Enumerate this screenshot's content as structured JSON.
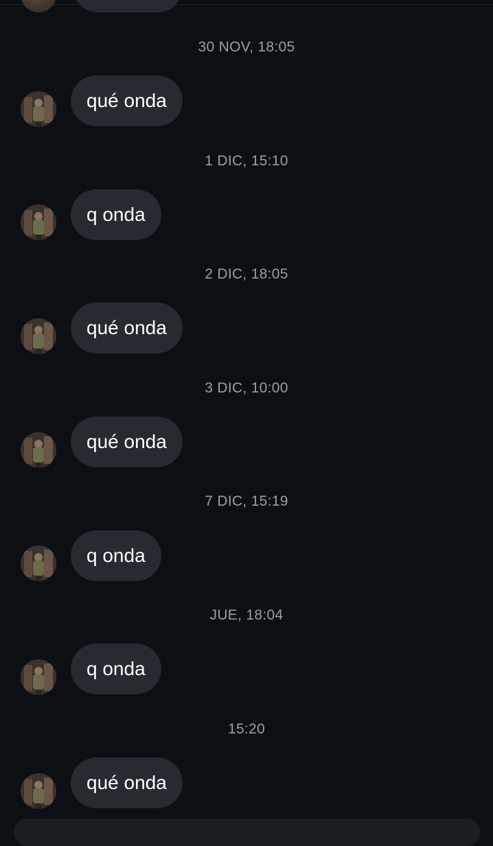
{
  "conversation": {
    "groups": [
      {
        "timestamp": "30 NOV, 18:05",
        "message": "qué onda"
      },
      {
        "timestamp": "1 DIC, 15:10",
        "message": "q onda"
      },
      {
        "timestamp": "2 DIC, 18:05",
        "message": "qué onda"
      },
      {
        "timestamp": "3 DIC, 10:00",
        "message": "qué onda"
      },
      {
        "timestamp": "7 DIC, 15:19",
        "message": "q onda"
      },
      {
        "timestamp": "JUE, 18:04",
        "message": "q onda"
      },
      {
        "timestamp": "15:20",
        "message": "qué onda"
      }
    ]
  },
  "colors": {
    "background": "#0c0f13",
    "bubble": "#262a31",
    "bubble_text": "#ffffff",
    "timestamp_text": "#9aa0a8"
  },
  "icons": {
    "avatar": "profile-photo"
  }
}
